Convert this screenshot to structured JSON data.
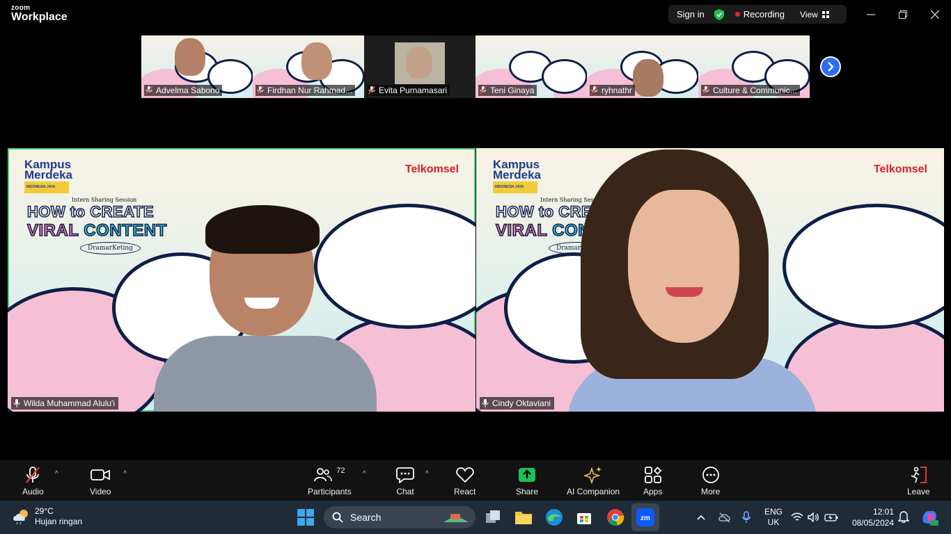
{
  "app": {
    "brand_small": "zoom",
    "brand_big": "Workplace"
  },
  "top_controls": {
    "sign_in": "Sign in",
    "recording": "Recording",
    "view": "View"
  },
  "thumbnails": [
    {
      "name": "Advelma Sabono"
    },
    {
      "name": "Firdhan Nur Rahmad..."
    },
    {
      "name": "Evita Purnamasari"
    },
    {
      "name": "Teni Ginaya"
    },
    {
      "name": "ryhnathr"
    },
    {
      "name": "Culture & Communic..."
    }
  ],
  "speakers": [
    {
      "name": "Wilda Muhammad Alulu'i"
    },
    {
      "name": "Cindy Oktaviani"
    }
  ],
  "background": {
    "logo_line1": "Kampus",
    "logo_line2": "Merdeka",
    "logo_tag": "INDONESIA JAYA",
    "brand": "Telkomsel",
    "session": "Intern Sharing Session",
    "title_line1": "HOW to CREATE",
    "title_viral": "VIRAL ",
    "title_content": "CONTENT",
    "tag": "DramarKeting"
  },
  "toolbar": {
    "audio": "Audio",
    "video": "Video",
    "participants": "Participants",
    "participants_count": "72",
    "chat": "Chat",
    "react": "React",
    "share": "Share",
    "ai_companion": "AI Companion",
    "apps": "Apps",
    "more": "More",
    "leave": "Leave"
  },
  "taskbar": {
    "temperature": "29°C",
    "weather": "Hujan ringan",
    "search": "Search",
    "lang1": "ENG",
    "lang2": "UK",
    "time": "12:01",
    "date": "08/05/2024"
  },
  "colors": {
    "accent_green": "#3fd27a",
    "recording_red": "#e02828",
    "next_blue": "#2d6cf5",
    "share_green": "#19c25b"
  }
}
